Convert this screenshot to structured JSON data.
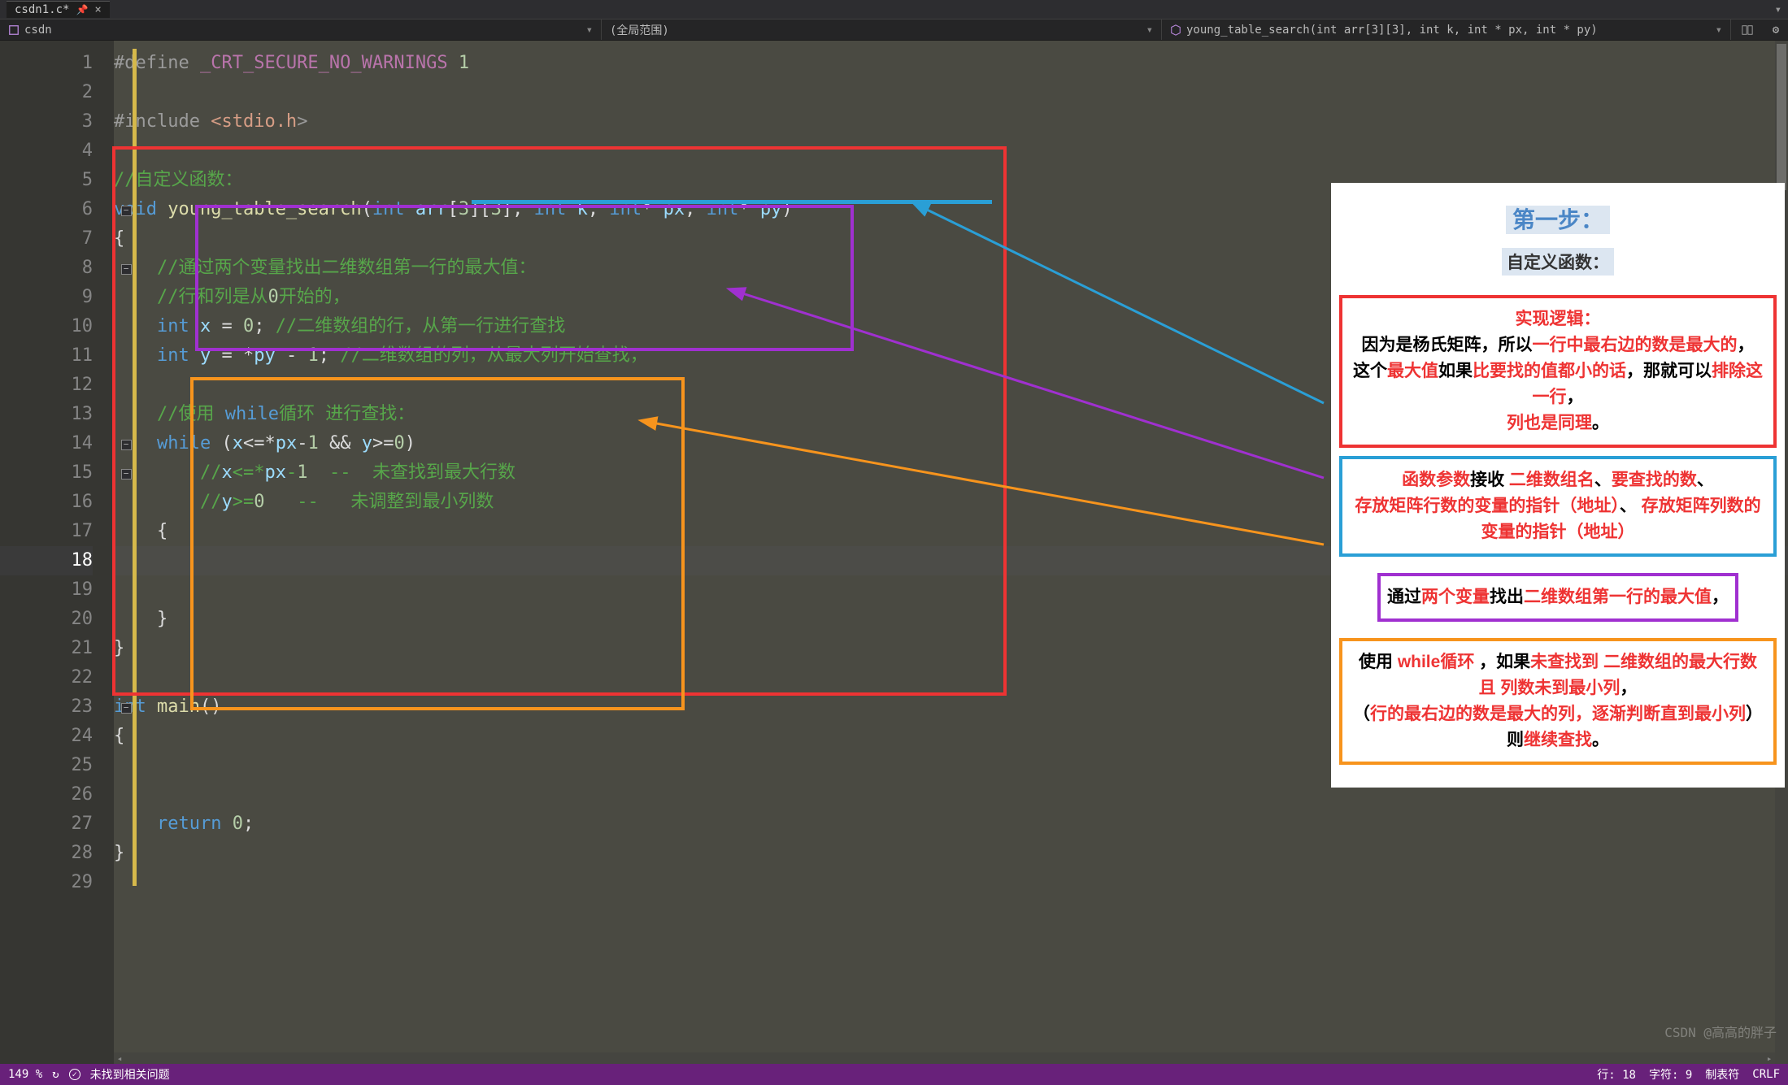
{
  "tab": {
    "filename": "csdn1.c*"
  },
  "nav": {
    "project_icon": "bracket-icon",
    "project": "csdn",
    "scope": "(全局范围)",
    "symbol_icon": "cube-icon",
    "symbol": "young_table_search(int arr[3][3], int k, int * px, int * py)"
  },
  "code": {
    "lines": [
      "#define _CRT_SECURE_NO_WARNINGS 1",
      "",
      "#include <stdio.h>",
      "",
      "//自定义函数：",
      "void young_table_search(int arr[3][3], int k, int* px, int* py)",
      "{",
      "    //通过两个变量找出二维数组第一行的最大值：",
      "    //行和列是从0开始的，",
      "    int x = 0; //二维数组的行，从第一行进行查找",
      "    int y = *py - 1; //二维数组的列，从最大列开始查找，",
      "",
      "    //使用 while循环 进行查找：",
      "    while (x<=*px-1 && y>=0)",
      "        //x<=*px-1  --  未查找到最大行数",
      "        //y>=0   --   未调整到最小列数",
      "    {",
      "",
      "",
      "    }",
      "}",
      "",
      "int main()",
      "{",
      "",
      "",
      "    return 0;",
      "}",
      ""
    ],
    "line_numbers": [
      1,
      2,
      3,
      4,
      5,
      6,
      7,
      8,
      9,
      10,
      11,
      12,
      13,
      14,
      15,
      16,
      17,
      18,
      19,
      20,
      21,
      22,
      23,
      24,
      25,
      26,
      27,
      28,
      29
    ],
    "current_line": 18
  },
  "panel": {
    "title": "第一步：",
    "subtitle": "自定义函数：",
    "box_red": {
      "l1": "实现逻辑：",
      "l2a": "因为是杨氏矩阵，所以",
      "l2b": "一行中最右边的数是最大的",
      "l2c": "，",
      "l3a": "这个",
      "l3b": "最大值",
      "l3c": "如果",
      "l3d": "比要找的值都小的话",
      "l3e": "，那就可以",
      "l3f": "排除这一行",
      "l3g": "，",
      "l4": "列也是同理",
      "l4b": "。"
    },
    "box_cyan": {
      "l1a": "函数参数",
      "l1b": "接收 ",
      "l1c": "二维数组名",
      "l1d": "、",
      "l1e": "要查找的数",
      "l1f": "、",
      "l2a": "存放矩阵行数的变量的指针（地址）",
      "l2b": "、 ",
      "l2c": "存放矩阵列数的变量的指针（地址）"
    },
    "box_purple": {
      "l1a": "通过",
      "l1b": "两个变量",
      "l1c": "找出",
      "l1d": "二维数组第一行的最大值",
      "l1e": "，"
    },
    "box_orange": {
      "l1a": "使用 ",
      "l1b": "while循环",
      "l1c": " ，如果",
      "l1d": "未查找到 二维数组的最大行数 且 列数未到最小列",
      "l1e": "，",
      "l2a": "（",
      "l2b": "行的最右边的数是最大的列，逐渐判断直到最小列",
      "l2c": "）",
      "l3a": "则",
      "l3b": "继续查找",
      "l3c": "。"
    }
  },
  "status": {
    "zoom": "149 %",
    "check": "✓",
    "no_issues": "未找到相关问题",
    "line_label": "行: ",
    "line_val": "18",
    "col_label": "字符: ",
    "col_val": "9",
    "tabs": "制表符",
    "crlf": "CRLF"
  },
  "watermark": "CSDN @高高的胖子"
}
